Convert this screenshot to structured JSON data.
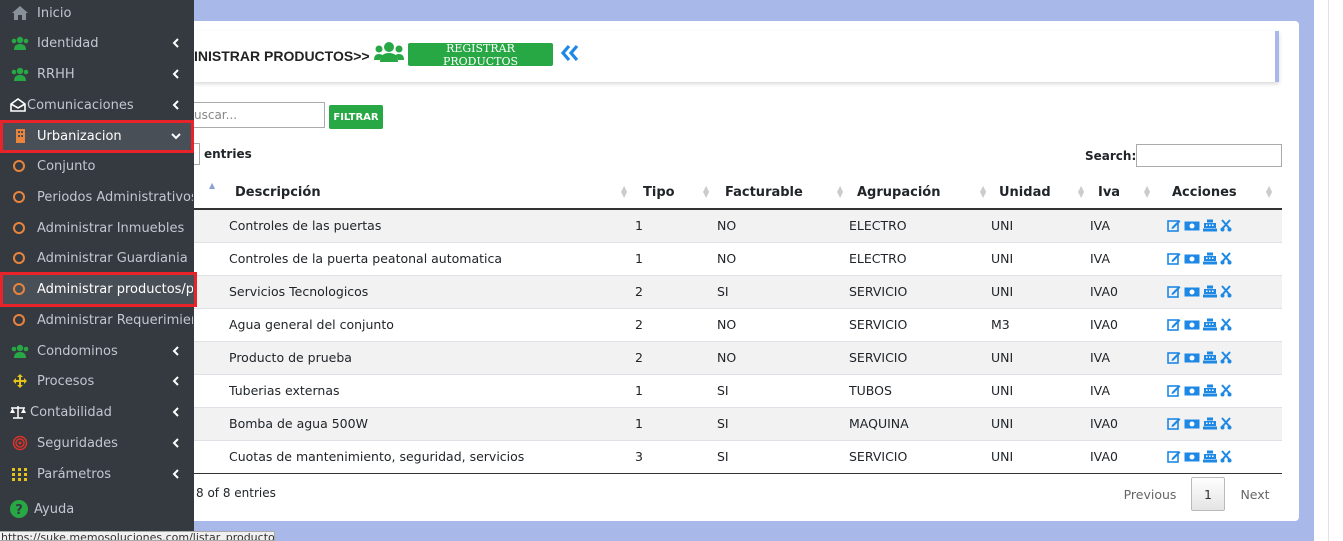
{
  "header": {
    "title": "INISTRAR PRODUCTOS>>",
    "register_label": "REGISTRAR PRODUCTOS"
  },
  "filter": {
    "search_placeholder": "uscar...",
    "filter_label": "FILTRAR"
  },
  "datatable": {
    "entries_label": "entries",
    "search_label": "Search:",
    "columns": [
      "Descripción",
      "Tipo",
      "Facturable",
      "Agrupación",
      "Unidad",
      "Iva",
      "Acciones"
    ],
    "rows": [
      [
        "Controles de las puertas",
        "1",
        "NO",
        "ELECTRO",
        "UNI",
        "IVA"
      ],
      [
        "Controles de la puerta peatonal automatica",
        "1",
        "NO",
        "ELECTRO",
        "UNI",
        "IVA"
      ],
      [
        "Servicios Tecnologicos",
        "2",
        "SI",
        "SERVICIO",
        "UNI",
        "IVA0"
      ],
      [
        "Agua general del conjunto",
        "2",
        "NO",
        "SERVICIO",
        "M3",
        "IVA0"
      ],
      [
        "Producto de prueba",
        "2",
        "NO",
        "SERVICIO",
        "UNI",
        "IVA"
      ],
      [
        "Tuberias externas",
        "1",
        "SI",
        "TUBOS",
        "UNI",
        "IVA"
      ],
      [
        "Bomba de agua 500W",
        "1",
        "SI",
        "MAQUINA",
        "UNI",
        "IVA0"
      ],
      [
        "Cuotas de mantenimiento, seguridad, servicios",
        "3",
        "SI",
        "SERVICIO",
        "UNI",
        "IVA0"
      ]
    ],
    "info": "8 of 8 entries",
    "previous": "Previous",
    "page": "1",
    "next": "Next"
  },
  "sidebar": {
    "items": [
      {
        "label": "Inicio",
        "icon": "home-icon"
      },
      {
        "label": "Identidad",
        "icon": "users-icon"
      },
      {
        "label": "RRHH",
        "icon": "users-icon"
      },
      {
        "label": "Comunicaciones",
        "icon": "envelope-open-icon"
      },
      {
        "label": "Urbanizacion",
        "icon": "building-icon"
      },
      {
        "label": "Conjunto"
      },
      {
        "label": "Periodos Administrativos"
      },
      {
        "label": "Administrar Inmuebles"
      },
      {
        "label": "Administrar Guardiania"
      },
      {
        "label": "Administrar productos/pre"
      },
      {
        "label": "Administrar Requerimiento"
      },
      {
        "label": "Condominos",
        "icon": "users-icon"
      },
      {
        "label": "Procesos",
        "icon": "arrows-icon"
      },
      {
        "label": "Contabilidad",
        "icon": "balance-scale-icon"
      },
      {
        "label": "Seguridades",
        "icon": "fingerprint-icon"
      },
      {
        "label": "Parámetros",
        "icon": "grid-icon"
      },
      {
        "label": "Ayuda",
        "icon": "question-icon"
      }
    ]
  },
  "status_url": "https://suke.memosoluciones.com/listar_productos/",
  "colors": {
    "sidebar": "#343a40",
    "green": "#28a745",
    "accent_blue": "#1e88e5",
    "highlight_red": "#e8232a",
    "sub_circle": "#e9843c"
  }
}
